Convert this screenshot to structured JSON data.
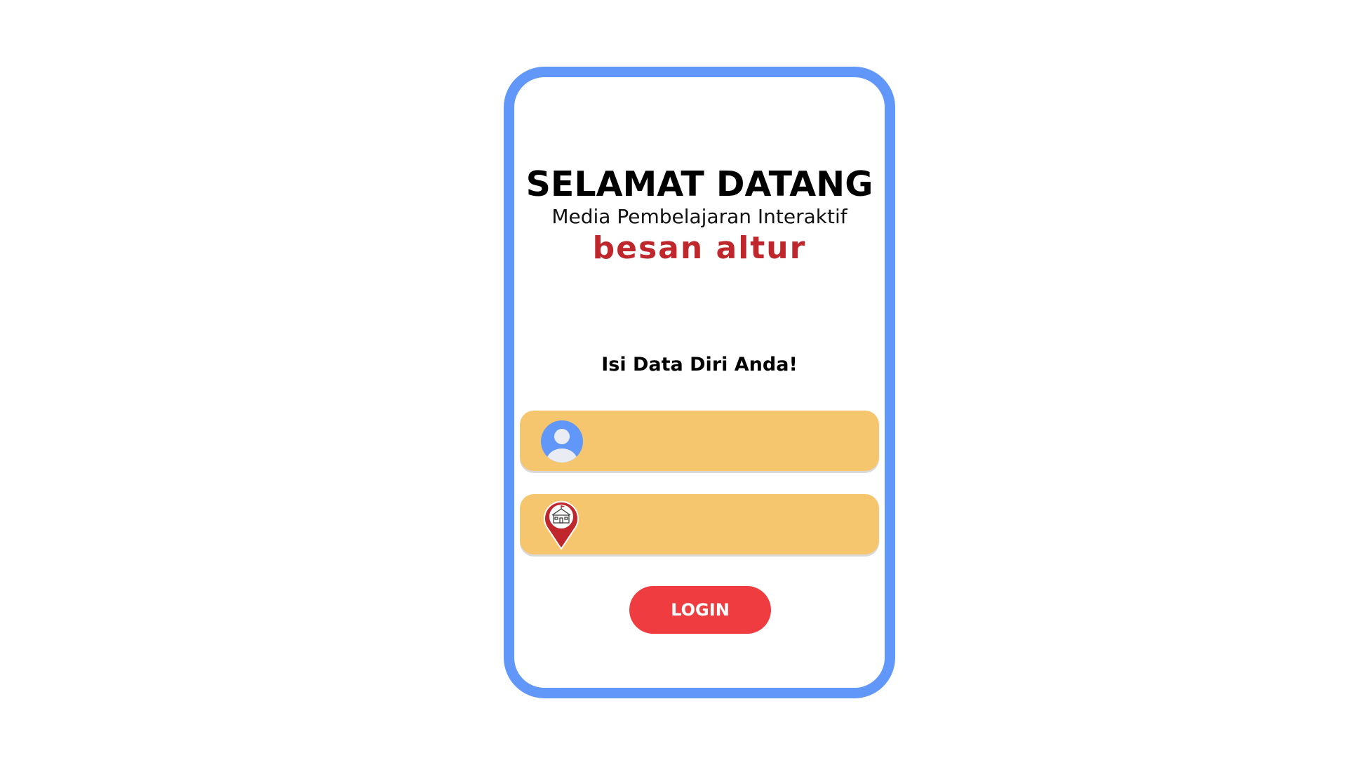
{
  "header": {
    "title": "SELAMAT DATANG",
    "subtitle": "Media Pembelajaran Interaktif",
    "brand": "besan altur"
  },
  "form": {
    "prompt": "Isi Data Diri Anda!",
    "name_field": {
      "icon": "user-avatar-icon",
      "value": "",
      "placeholder": ""
    },
    "school_field": {
      "icon": "school-location-pin-icon",
      "value": "",
      "placeholder": ""
    },
    "login_label": "LOGIN"
  },
  "colors": {
    "frame": "#6097f8",
    "field": "#f5c66e",
    "button": "#ef3c40",
    "brand": "#c0272d",
    "avatar": "#6097f8"
  }
}
